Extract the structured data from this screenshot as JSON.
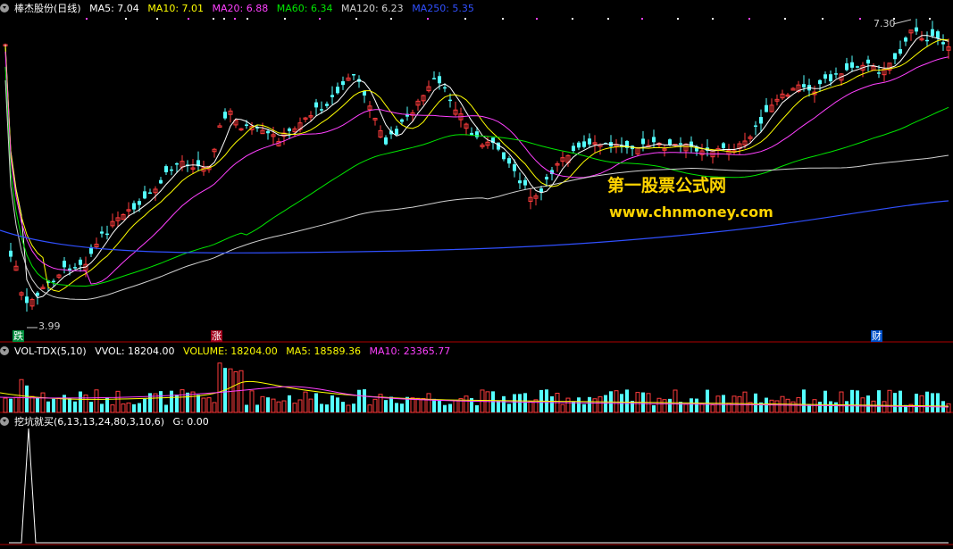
{
  "main_panel": {
    "stock": "棒杰股份(日线)",
    "ma_labels": [
      {
        "text": "MA5: 7.04",
        "color": "#ffffff"
      },
      {
        "text": "MA10: 7.01",
        "color": "#ffff00"
      },
      {
        "text": "MA20: 6.88",
        "color": "#ff40ff"
      },
      {
        "text": "MA60: 6.34",
        "color": "#00e600"
      },
      {
        "text": "MA120: 6.23",
        "color": "#d0d0d0"
      },
      {
        "text": "MA250: 5.35",
        "color": "#3050ff"
      }
    ],
    "high_label": "7.30",
    "low_label": "3.99",
    "markers": [
      {
        "text": "跌",
        "bg": "#008c3c",
        "fg": "#ffffff"
      },
      {
        "text": "涨",
        "bg": "#a0001c",
        "fg": "#ffffff"
      },
      {
        "text": "财",
        "bg": "#0050c8",
        "fg": "#ffffff"
      }
    ]
  },
  "watermark": {
    "title": "第一股票公式网",
    "url": "www.chnmoney.com"
  },
  "volume_panel": {
    "name": "VOL-TDX(5,10)",
    "labels": [
      {
        "text": "VVOL: 18204.00",
        "color": "#ffffff"
      },
      {
        "text": "VOLUME: 18204.00",
        "color": "#ffff00"
      },
      {
        "text": "MA5: 18589.36",
        "color": "#ffff00"
      },
      {
        "text": "MA10: 23365.77",
        "color": "#ff40ff"
      }
    ]
  },
  "indicator_panel": {
    "name": "挖坑就买(6,13,13,24,80,3,10,6)",
    "labels": [
      {
        "text": "G: 0.00",
        "color": "#ffffff"
      }
    ]
  },
  "colors": {
    "up": "#ff3c3c",
    "down": "#54ffff",
    "frame": "#b00000",
    "ma5": "#ffffff",
    "ma10": "#ffff00",
    "ma20": "#ff40ff",
    "ma60": "#00e600",
    "ma120": "#d0d0d0",
    "ma250": "#3050ff"
  }
}
